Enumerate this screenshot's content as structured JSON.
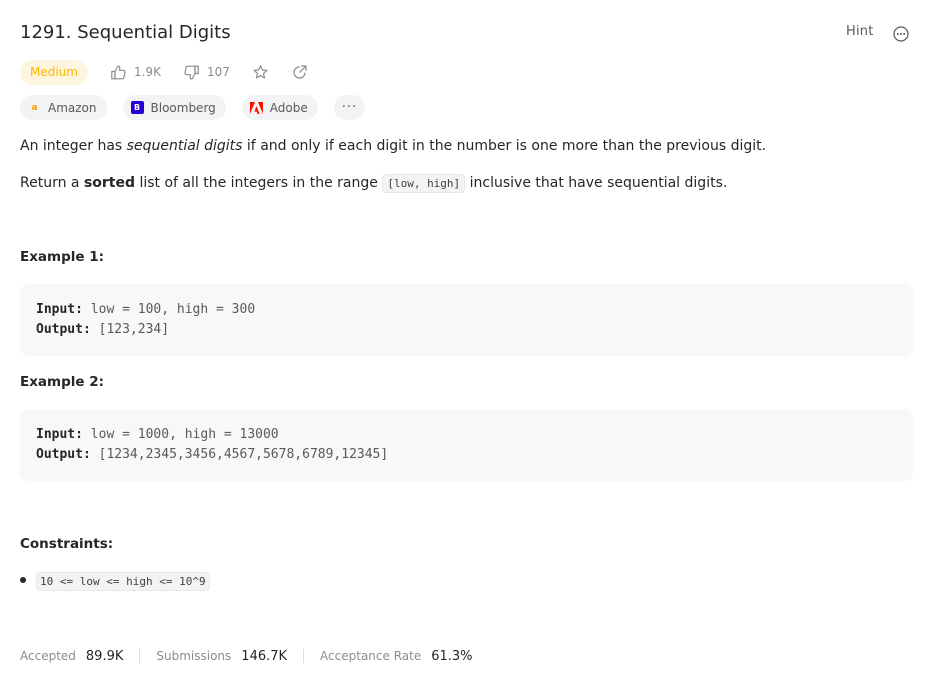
{
  "problem": {
    "title": "1291. Sequential Digits",
    "hint_label": "Hint",
    "difficulty": "Medium",
    "likes": "1.9K",
    "dislikes": "107"
  },
  "companies": [
    {
      "name": "Amazon",
      "logo_icon": "amazon-logo-icon"
    },
    {
      "name": "Bloomberg",
      "logo_icon": "bloomberg-logo-icon"
    },
    {
      "name": "Adobe",
      "logo_icon": "adobe-logo-icon"
    }
  ],
  "more_tags_label": "···",
  "description": {
    "line1_pre": "An integer has ",
    "line1_em": "sequential digits",
    "line1_post": " if and only if each digit in the number is one more than the previous digit.",
    "line2_pre": "Return a ",
    "line2_bold": "sorted",
    "line2_mid": " list of all the integers in the range ",
    "line2_code": "[low, high]",
    "line2_post": " inclusive that have sequential digits."
  },
  "examples": [
    {
      "heading": "Example 1:",
      "input_label": "Input:",
      "input_value": "low = 100, high = 300",
      "output_label": "Output:",
      "output_value": "[123,234]"
    },
    {
      "heading": "Example 2:",
      "input_label": "Input:",
      "input_value": "low = 1000, high = 13000",
      "output_label": "Output:",
      "output_value": "[1234,2345,3456,4567,5678,6789,12345]"
    }
  ],
  "constraints": {
    "heading": "Constraints:",
    "items": [
      "10 <= low <= high <= 10^9"
    ]
  },
  "stats": {
    "accepted_label": "Accepted",
    "accepted_value": "89.9K",
    "submissions_label": "Submissions",
    "submissions_value": "146.7K",
    "rate_label": "Acceptance Rate",
    "rate_value": "61.3%"
  },
  "colors": {
    "difficulty_medium": "#ffb700",
    "difficulty_bg": "#fef5de",
    "amazon": "#ff9900",
    "bloomberg": "#2800d7",
    "adobe": "#fa0f00"
  }
}
